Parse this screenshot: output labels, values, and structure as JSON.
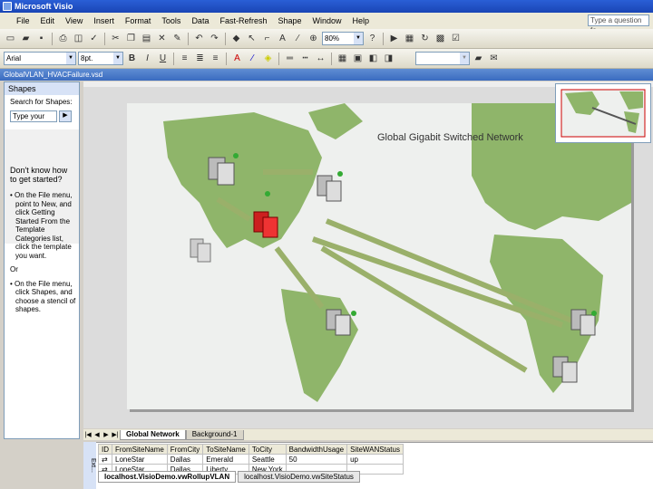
{
  "window": {
    "title": "Microsoft Visio"
  },
  "menu": [
    "File",
    "Edit",
    "View",
    "Insert",
    "Format",
    "Tools",
    "Data",
    "Fast-Refresh",
    "Shape",
    "Window",
    "Help"
  ],
  "help_box": {
    "placeholder": "Type a question fo"
  },
  "toolbar": {
    "zoom": "80%",
    "font": "Arial",
    "font_size": "8pt.",
    "text_buttons": {
      "bold": "B",
      "italic": "I",
      "underline": "U"
    }
  },
  "document": {
    "title": "GlobalVLAN_HVACFailure.vsd"
  },
  "shapes_panel": {
    "title": "Shapes",
    "search_label": "Search for Shapes:",
    "search_placeholder": "Type your",
    "help_heading": "Don't know how to get started?",
    "help_items": [
      "On the File menu, point to New, and click Getting Started From the Template Categories list, click the template you want.",
      "On the File menu, click Shapes, and choose a stencil of shapes."
    ],
    "or_text": "Or"
  },
  "diagram": {
    "title": "Global Gigabit Switched Network",
    "colors": {
      "land": "#8fb56a",
      "alert": "#cc1f1f",
      "ocean": "#eef0ee"
    }
  },
  "page_tabs": [
    "Global Network",
    "Background-1"
  ],
  "external_data": {
    "label": "Ext...",
    "columns": [
      "ID",
      "FromSiteName",
      "FromCity",
      "ToSiteName",
      "ToCity",
      "BandwidthUsage",
      "SiteWANStatus"
    ],
    "rows": [
      [
        "",
        "LoneStar",
        "Dallas",
        "Emerald",
        "Seattle",
        "50",
        "up"
      ],
      [
        "",
        "LoneStar",
        "Dallas",
        "Liberty",
        "New York",
        "",
        ""
      ]
    ],
    "tabs": [
      "localhost.VisioDemo.vwRollupVLAN",
      "localhost.VisioDemo.vwSiteStatus"
    ]
  }
}
